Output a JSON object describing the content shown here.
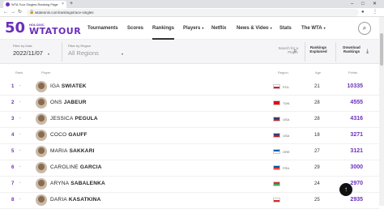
{
  "browser": {
    "tab_title": "WTA Tour Singles Ranking Page",
    "url": "wtatennis.com/rankings/race-singles",
    "new_tab_symbol": "+",
    "close_symbol": "×"
  },
  "nav": {
    "logo_50": "50",
    "logo_hologic": "HOLOGIC",
    "logo_wta": "WTATOUR",
    "items": [
      {
        "label": "Tournaments",
        "caret": ""
      },
      {
        "label": "Scores",
        "caret": ""
      },
      {
        "label": "Rankings",
        "caret": ""
      },
      {
        "label": "Players",
        "caret": "▾"
      },
      {
        "label": "Netflix",
        "caret": ""
      },
      {
        "label": "News & Video",
        "caret": "▾"
      },
      {
        "label": "Stats",
        "caret": ""
      },
      {
        "label": "The WTA",
        "caret": "▾"
      }
    ]
  },
  "filters": {
    "date_label": "Filter by Date",
    "date_value": "2022/11/07",
    "region_label": "Filter by Region",
    "region_value": "All Regions",
    "search_placeholder": "Search for a Player",
    "rankings_explained": "Rankings Explained",
    "download_rankings": "Download Rankings"
  },
  "table": {
    "headers": {
      "rank": "Rank",
      "player": "Player",
      "region": "Region",
      "age": "Age",
      "points": "Points"
    },
    "rows": [
      {
        "rank": "1",
        "move": "-",
        "first": "IGA",
        "last": "SWIATEK",
        "country": "POL",
        "flag_top": "#ffffff",
        "flag_bottom": "#dc143c",
        "age": "21",
        "points": "10335"
      },
      {
        "rank": "2",
        "move": "-",
        "first": "ONS",
        "last": "JABEUR",
        "country": "TUN",
        "flag_top": "#e70013",
        "flag_bottom": "#e70013",
        "age": "28",
        "points": "4555"
      },
      {
        "rank": "3",
        "move": "-",
        "first": "JESSICA",
        "last": "PEGULA",
        "country": "USA",
        "flag_top": "#3c3b6e",
        "flag_bottom": "#b22234",
        "age": "28",
        "points": "4316"
      },
      {
        "rank": "4",
        "move": "-",
        "first": "COCO",
        "last": "GAUFF",
        "country": "USA",
        "flag_top": "#3c3b6e",
        "flag_bottom": "#b22234",
        "age": "18",
        "points": "3271"
      },
      {
        "rank": "5",
        "move": "-",
        "first": "MARIA",
        "last": "SAKKARI",
        "country": "GRE",
        "flag_top": "#0d5eaf",
        "flag_bottom": "#ffffff",
        "age": "27",
        "points": "3121"
      },
      {
        "rank": "6",
        "move": "-",
        "first": "CAROLINE",
        "last": "GARCIA",
        "country": "FRA",
        "flag_top": "#0055a4",
        "flag_bottom": "#ef4135",
        "age": "29",
        "points": "3000"
      },
      {
        "rank": "7",
        "move": "-",
        "first": "ARYNA",
        "last": "SABALENKA",
        "country": "",
        "flag_top": "#c8313e",
        "flag_bottom": "#4aa657",
        "age": "24",
        "points": "2970"
      },
      {
        "rank": "8",
        "move": "-",
        "first": "DARIA",
        "last": "KASATKINA",
        "country": "",
        "flag_top": "#ffffff",
        "flag_bottom": "#d52b1e",
        "age": "25",
        "points": "2935"
      }
    ]
  },
  "scroll_top_symbol": "↑"
}
